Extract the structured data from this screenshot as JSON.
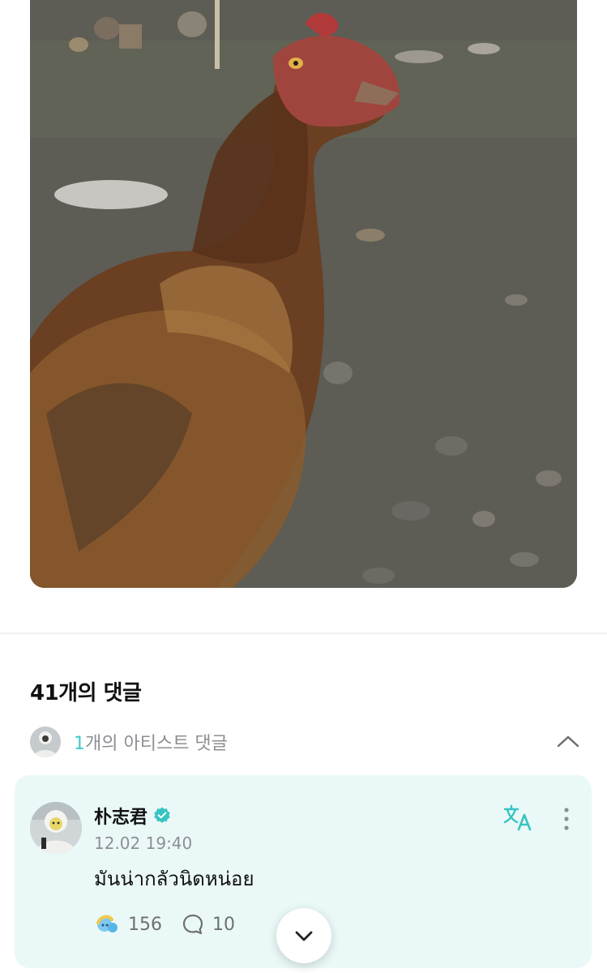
{
  "post": {
    "image": {
      "subject": "rooster photo"
    }
  },
  "comments": {
    "title": "41개의 댓글",
    "artist_count": "1",
    "artist_label_suffix": "개의 아티스트 댓글"
  },
  "comment": {
    "author": "朴志君",
    "verified": true,
    "timestamp": "12.02 19:40",
    "text": "มันน่ากลัวนิดหน่อย",
    "likes": "156",
    "replies": "10"
  },
  "icons": {
    "collapse": "chevron-up-icon",
    "translate": "translate-icon",
    "more": "more-vertical-icon",
    "like": "like-reaction-icon",
    "reply": "reply-bubble-icon",
    "scroll": "chevron-down-icon",
    "verified": "verified-badge-icon"
  },
  "colors": {
    "accent": "#3ec9c7",
    "verified": "#37c4c2",
    "card_bg": "#eaf9f8",
    "muted_text": "#8e8e93"
  }
}
